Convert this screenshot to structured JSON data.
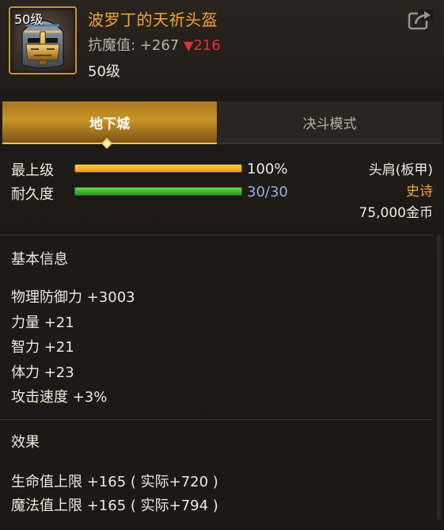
{
  "item": {
    "level_badge": "50级",
    "name": "波罗丁的天祈头盔",
    "stat_label": "抗魔值:",
    "stat_value": "+267",
    "stat_down_arrow": "▼",
    "stat_down_value": "216",
    "required_level": "50级",
    "icon": "helmet-icon"
  },
  "header": {
    "share_icon": "share-icon"
  },
  "tabs": [
    {
      "label": "地下城",
      "active": true
    },
    {
      "label": "决斗模式",
      "active": false
    }
  ],
  "bars": {
    "grade": {
      "label": "最上级",
      "value_text": "100%",
      "fraction": 1.0
    },
    "durability": {
      "label": "耐久度",
      "value_text": "30/30",
      "fraction": 1.0
    }
  },
  "info": {
    "slot": "头肩(板甲)",
    "rarity": "史诗",
    "price": "75,000金币"
  },
  "basic": {
    "title": "基本信息",
    "attributes": [
      "物理防御力 +3003",
      "力量 +21",
      "智力 +21",
      "体力 +23",
      "攻击速度 +3%"
    ]
  },
  "effects": {
    "title": "效果",
    "lines": [
      "生命值上限 +165 ( 实际+720 )",
      "魔法值上限 +165 ( 实际+794 )"
    ]
  },
  "colors": {
    "item_name": "#f2a531",
    "rarity": "#f2a531",
    "decrease": "#e23333",
    "durability_text": "#8fb1d8",
    "tab_active": "#c89428"
  }
}
